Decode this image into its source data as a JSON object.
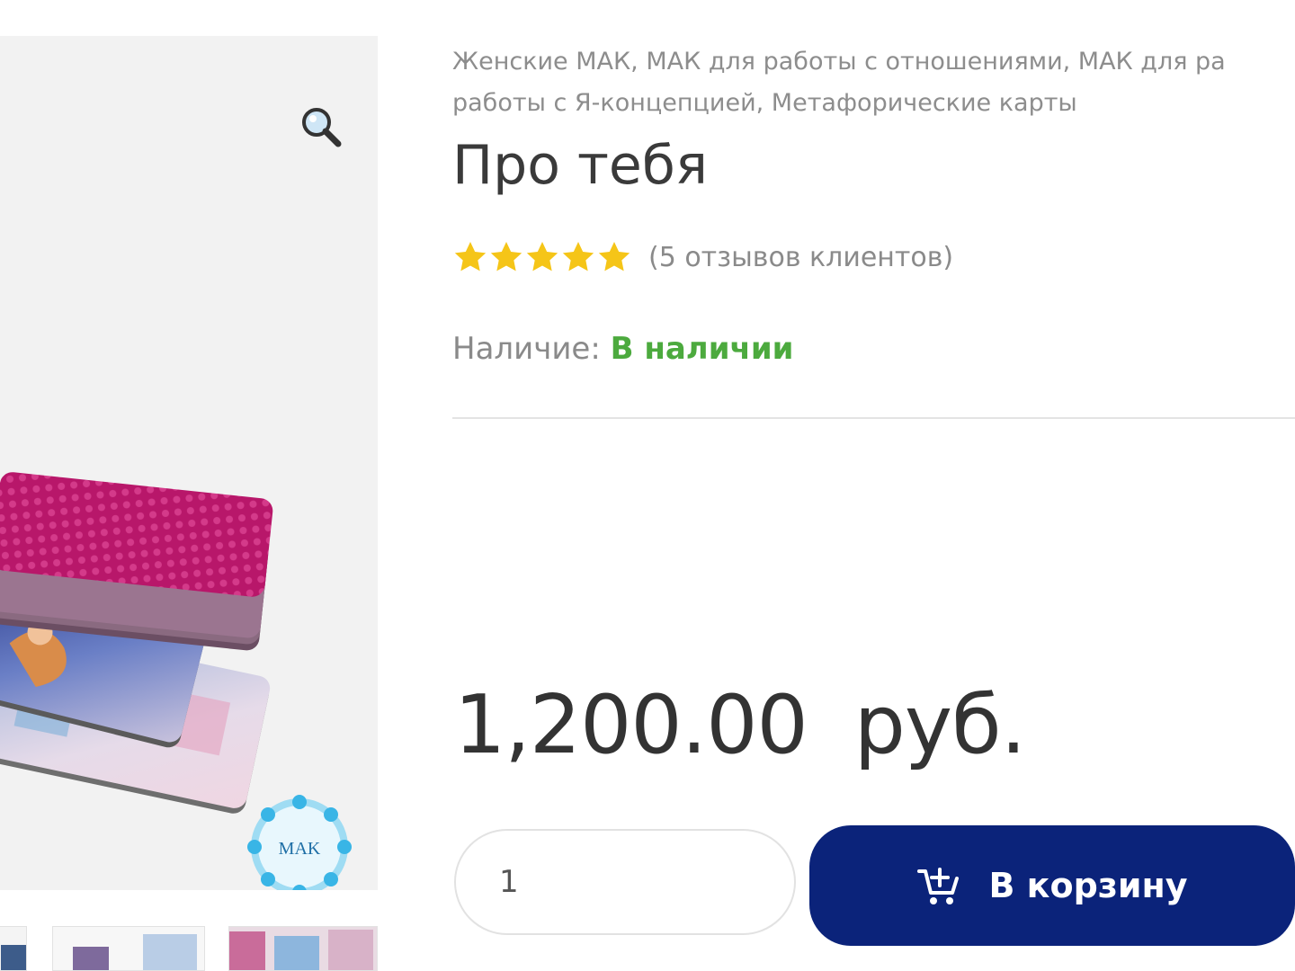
{
  "product": {
    "categories": [
      "Женские МАК",
      "МАК для работы с отношениями",
      "МАК для работы с Я-концепцией",
      "Метафорические карты"
    ],
    "categories_line1": "Женские МАК, МАК для работы с отношениями, МАК для ра",
    "categories_line2": "работы с Я-концепцией, Метафорические карты",
    "title": "Про тебя",
    "rating": {
      "value": 5,
      "max": 5,
      "reviews_text": "(5 отзывов клиентов)"
    },
    "availability": {
      "label": "Наличие:",
      "value": "В наличии"
    },
    "price": {
      "amount": "1,200.00",
      "currency": "руб."
    },
    "quantity": "1",
    "add_to_cart_label": "В корзину"
  },
  "gallery": {
    "logo_text": "MAK",
    "thumbnail_count": 3
  },
  "icons": {
    "zoom": "magnifier-icon",
    "cart": "cart-add-icon",
    "star": "star-icon"
  },
  "colors": {
    "button_bg": "#0b237a",
    "in_stock": "#4caa3e",
    "star": "#f5c518"
  }
}
